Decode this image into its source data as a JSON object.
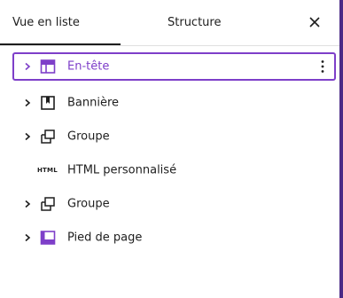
{
  "tabs": {
    "list_view": "Vue en liste",
    "outline": "Structure"
  },
  "close_icon": "close-icon",
  "items": [
    {
      "label": "En-tête",
      "icon": "header-template-icon",
      "has_chevron": true,
      "selected": true
    },
    {
      "label": "Bannière",
      "icon": "bookmark-icon",
      "has_chevron": true,
      "selected": false
    },
    {
      "label": "Groupe",
      "icon": "group-icon",
      "has_chevron": true,
      "selected": false
    },
    {
      "label": "HTML personnalisé",
      "icon": "html-icon",
      "icon_text": "HTML",
      "has_chevron": false,
      "selected": false
    },
    {
      "label": "Groupe",
      "icon": "group-icon",
      "has_chevron": true,
      "selected": false
    },
    {
      "label": "Pied de page",
      "icon": "footer-template-icon",
      "has_chevron": true,
      "selected": false
    }
  ],
  "colors": {
    "accent": "#7e3fc9",
    "text": "#1e1e1e",
    "divider": "#e0e0e0"
  }
}
